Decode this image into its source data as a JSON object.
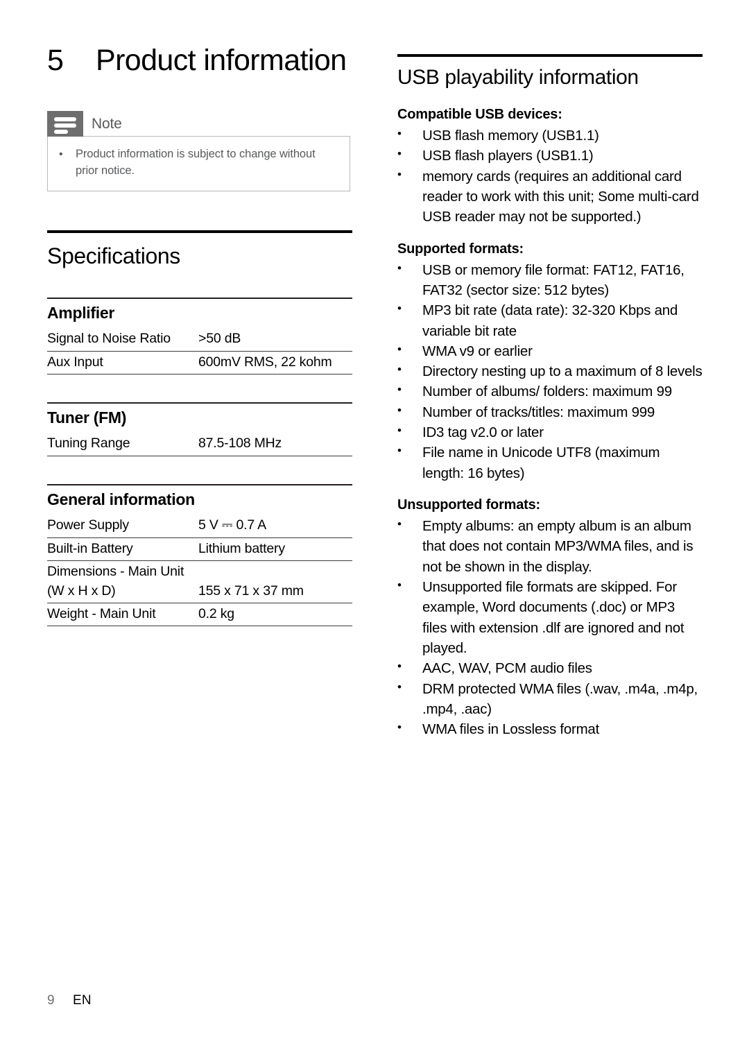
{
  "chapter": {
    "number": "5",
    "title": "Product information"
  },
  "note": {
    "icon": "note-lines-icon",
    "label": "Note",
    "items": [
      "Product information is subject to change without prior notice."
    ]
  },
  "specifications": {
    "heading": "Specifications",
    "groups": [
      {
        "name": "Amplifier",
        "rows": [
          {
            "key": "Signal to Noise Ratio",
            "value": ">50 dB"
          },
          {
            "key": "Aux Input",
            "value": "600mV RMS, 22 kohm"
          }
        ]
      },
      {
        "name": "Tuner (FM)",
        "rows": [
          {
            "key": "Tuning Range",
            "value": "87.5-108 MHz"
          }
        ]
      },
      {
        "name": "General information",
        "rows": [
          {
            "key": "Power Supply",
            "value": "5 V ⎓ 0.7 A"
          },
          {
            "key": "Built-in Battery",
            "value": "Lithium battery"
          },
          {
            "key": "Dimensions - Main Unit",
            "value": ""
          },
          {
            "key": "(W x H x D)",
            "value": "155 x 71 x 37 mm"
          },
          {
            "key": "Weight - Main Unit",
            "value": "0.2 kg"
          }
        ]
      }
    ]
  },
  "usb": {
    "heading": "USB playability information",
    "blocks": [
      {
        "heading": "Compatible USB devices:",
        "items": [
          "USB flash memory (USB1.1)",
          "USB flash players (USB1.1)",
          "memory cards (requires an additional card reader to work with this unit; Some multi-card USB reader may not be supported.)"
        ]
      },
      {
        "heading": "Supported formats:",
        "items": [
          "USB or memory file format: FAT12, FAT16, FAT32 (sector size: 512 bytes)",
          "MP3 bit rate (data rate): 32-320 Kbps and variable bit rate",
          "WMA v9 or earlier",
          "Directory nesting up to a maximum of 8 levels",
          "Number of albums/ folders: maximum 99",
          "Number of tracks/titles: maximum 999",
          "ID3 tag v2.0 or later",
          "File name in Unicode UTF8 (maximum length: 16 bytes)"
        ]
      },
      {
        "heading": "Unsupported formats:",
        "items": [
          "Empty albums: an empty album is an album that does not contain MP3/WMA files, and is not be shown in the display.",
          "Unsupported file formats are skipped. For example, Word documents (.doc) or MP3 files with extension .dlf are ignored and not played.",
          "AAC, WAV, PCM audio files",
          "DRM protected WMA files (.wav, .m4a, .m4p, .mp4, .aac)",
          "WMA files in Lossless format"
        ]
      }
    ]
  },
  "footer": {
    "page": "9",
    "language": "EN"
  },
  "bullet_glyph": "•"
}
